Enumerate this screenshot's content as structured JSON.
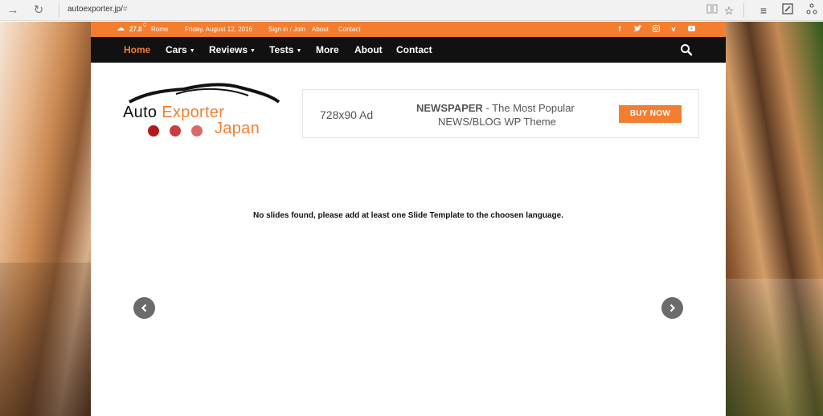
{
  "browser": {
    "url_host": "autoexporter.jp/",
    "url_hash": "#"
  },
  "topbar": {
    "temperature": "27.8",
    "temp_unit": "C",
    "city": "Rome",
    "date": "Friday, August 12, 2016",
    "links": [
      "Sign in / Join",
      "About",
      "Contact"
    ],
    "social_icons": [
      "facebook-icon",
      "twitter-icon",
      "instagram-icon",
      "vimeo-icon",
      "youtube-icon"
    ]
  },
  "nav": {
    "items": [
      {
        "label": "Home",
        "active": true,
        "dropdown": false
      },
      {
        "label": "Cars",
        "active": false,
        "dropdown": true
      },
      {
        "label": "Reviews",
        "active": false,
        "dropdown": true
      },
      {
        "label": "Tests",
        "active": false,
        "dropdown": true
      },
      {
        "label": "More",
        "active": false,
        "dropdown": false
      },
      {
        "label": "About",
        "active": false,
        "dropdown": false
      },
      {
        "label": "Contact",
        "active": false,
        "dropdown": false
      }
    ]
  },
  "logo": {
    "word1": "Auto",
    "word2": "Exporter",
    "word3": "Japan"
  },
  "ad": {
    "size": "728x90 Ad",
    "brand": "NEWSPAPER",
    "line1_rest": " - The Most Popular",
    "line2": "NEWS/BLOG WP Theme",
    "button": "BUY NOW"
  },
  "slider": {
    "message": "No slides found, please add at least one Slide Template to the choosen language."
  },
  "colors": {
    "accent": "#f37e2f",
    "nav_bg": "#111111",
    "logo_dot_dark": "#b11a1a",
    "logo_dot_mid": "#c83e3e",
    "logo_dot_light": "#d76b6b"
  }
}
